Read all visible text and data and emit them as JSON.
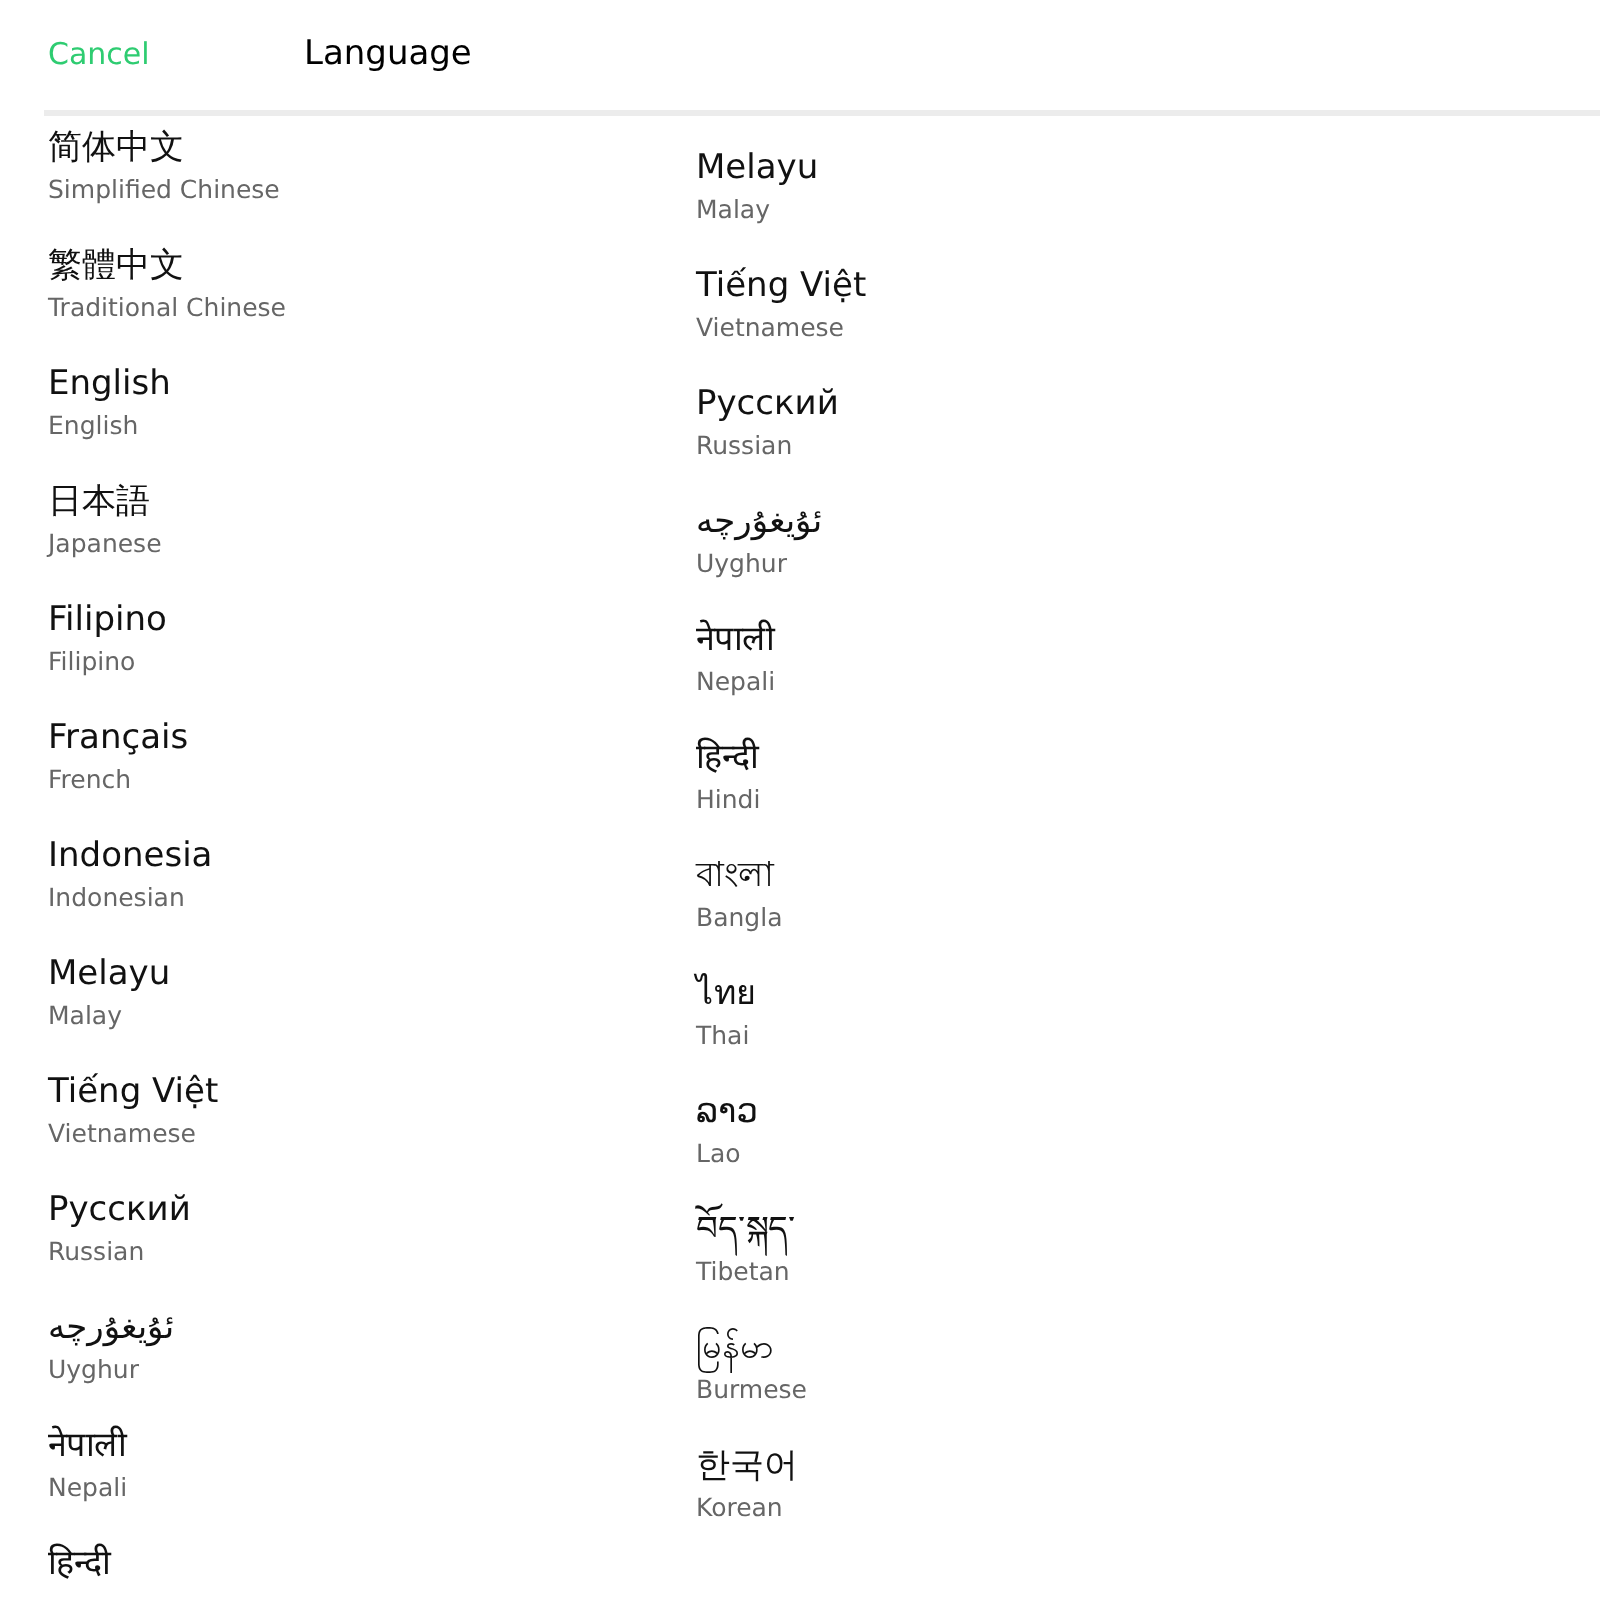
{
  "header": {
    "cancel": "Cancel",
    "title": "Language"
  },
  "columns": [
    [
      {
        "native": "简体中文",
        "english": "Simplified Chinese"
      },
      {
        "native": "繁體中文",
        "english": "Traditional Chinese"
      },
      {
        "native": "English",
        "english": "English"
      },
      {
        "native": "日本語",
        "english": "Japanese"
      },
      {
        "native": "Filipino",
        "english": "Filipino"
      },
      {
        "native": "Français",
        "english": "French"
      },
      {
        "native": "Indonesia",
        "english": "Indonesian"
      },
      {
        "native": "Melayu",
        "english": "Malay"
      },
      {
        "native": "Tiếng Việt",
        "english": "Vietnamese"
      },
      {
        "native": "Русский",
        "english": "Russian"
      },
      {
        "native": "ئۇيغۇرچە",
        "english": "Uyghur"
      },
      {
        "native": "नेपाली",
        "english": "Nepali"
      },
      {
        "native": "हिन्दी"
      }
    ],
    [
      {
        "native": "Melayu",
        "english": "Malay"
      },
      {
        "native": "Tiếng Việt",
        "english": "Vietnamese"
      },
      {
        "native": "Русский",
        "english": "Russian"
      },
      {
        "native": "ئۇيغۇرچە",
        "english": "Uyghur"
      },
      {
        "native": "नेपाली",
        "english": "Nepali"
      },
      {
        "native": "हिन्दी",
        "english": "Hindi"
      },
      {
        "native": "বাংলা",
        "english": "Bangla"
      },
      {
        "native": "ไทย",
        "english": "Thai"
      },
      {
        "native": "ລາວ",
        "english": "Lao"
      },
      {
        "native": "བོད་སྐད་",
        "english": "Tibetan"
      },
      {
        "native": "မြန်မာ",
        "english": "Burmese"
      },
      {
        "native": "한국어",
        "english": "Korean"
      }
    ]
  ]
}
